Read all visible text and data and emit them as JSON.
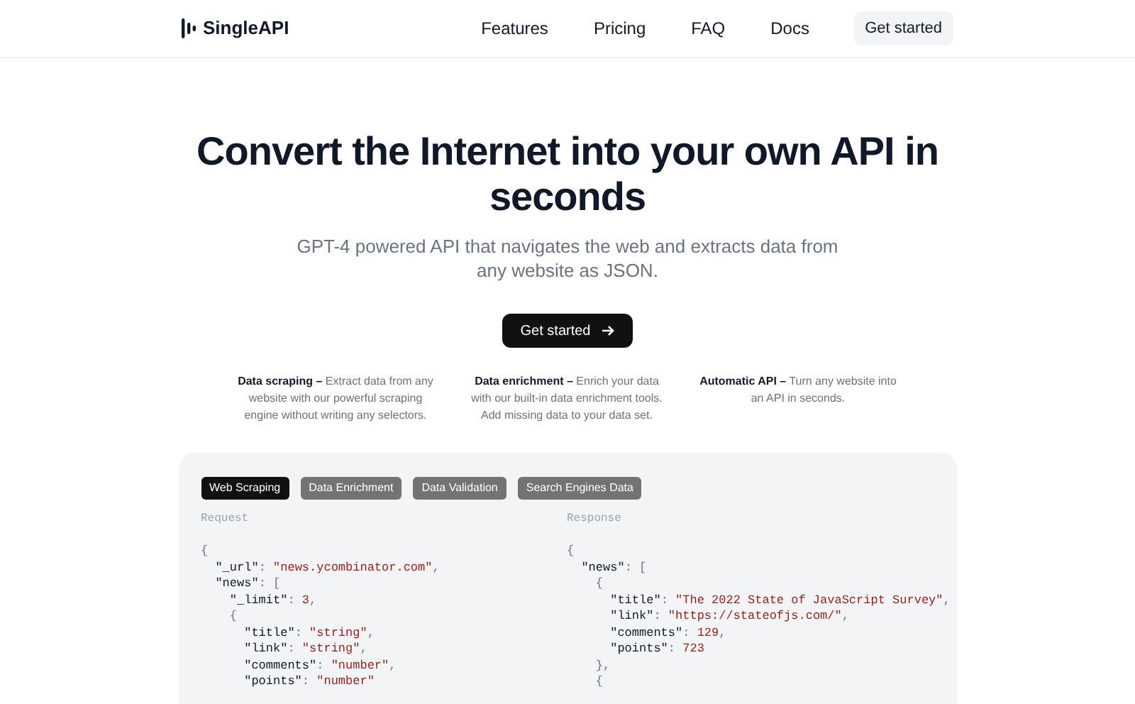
{
  "nav": {
    "brand": "SingleAPI",
    "links": [
      "Features",
      "Pricing",
      "FAQ",
      "Docs"
    ],
    "cta": "Get started"
  },
  "hero": {
    "title": "Convert the Internet into your own API in seconds",
    "subtitle": "GPT-4 powered API that navigates the web and extracts data from any website as JSON.",
    "button": "Get started"
  },
  "features": [
    {
      "name": "Data scraping –",
      "text": "Extract data from any website with our powerful scraping engine without writing any selectors."
    },
    {
      "name": "Data enrichment –",
      "text": "Enrich your data with our built-in data enrichment tools. Add missing data to your data set."
    },
    {
      "name": "Automatic API –",
      "text": "Turn any website into an API in seconds."
    }
  ],
  "demo": {
    "tabs": [
      {
        "label": "Web Scraping",
        "selected": true
      },
      {
        "label": "Data Enrichment",
        "selected": false
      },
      {
        "label": "Data Validation",
        "selected": false
      },
      {
        "label": "Search Engines Data",
        "selected": false
      }
    ],
    "panes": [
      {
        "label": "Request",
        "lines": [
          [
            {
              "kind": "punct",
              "text": "{"
            }
          ],
          [
            {
              "kind": "key",
              "text": "  \"_url\""
            },
            {
              "kind": "punct",
              "text": ": "
            },
            {
              "kind": "string",
              "text": "\"news.ycombinator.com\""
            },
            {
              "kind": "punct",
              "text": ","
            }
          ],
          [
            {
              "kind": "key",
              "text": "  \"news\""
            },
            {
              "kind": "punct",
              "text": ": ["
            }
          ],
          [
            {
              "kind": "key",
              "text": "    \"_limit\""
            },
            {
              "kind": "punct",
              "text": ": "
            },
            {
              "kind": "number",
              "text": "3"
            },
            {
              "kind": "punct",
              "text": ","
            }
          ],
          [
            {
              "kind": "punct",
              "text": "    {"
            }
          ],
          [
            {
              "kind": "key",
              "text": "      \"title\""
            },
            {
              "kind": "punct",
              "text": ": "
            },
            {
              "kind": "string",
              "text": "\"string\""
            },
            {
              "kind": "punct",
              "text": ","
            }
          ],
          [
            {
              "kind": "key",
              "text": "      \"link\""
            },
            {
              "kind": "punct",
              "text": ": "
            },
            {
              "kind": "string",
              "text": "\"string\""
            },
            {
              "kind": "punct",
              "text": ","
            }
          ],
          [
            {
              "kind": "key",
              "text": "      \"comments\""
            },
            {
              "kind": "punct",
              "text": ": "
            },
            {
              "kind": "string",
              "text": "\"number\""
            },
            {
              "kind": "punct",
              "text": ","
            }
          ],
          [
            {
              "kind": "key",
              "text": "      \"points\""
            },
            {
              "kind": "punct",
              "text": ": "
            },
            {
              "kind": "string",
              "text": "\"number\""
            }
          ]
        ]
      },
      {
        "label": "Response",
        "lines": [
          [
            {
              "kind": "punct",
              "text": "{"
            }
          ],
          [
            {
              "kind": "key",
              "text": "  \"news\""
            },
            {
              "kind": "punct",
              "text": ": ["
            }
          ],
          [
            {
              "kind": "punct",
              "text": "    {"
            }
          ],
          [
            {
              "kind": "key",
              "text": "      \"title\""
            },
            {
              "kind": "punct",
              "text": ": "
            },
            {
              "kind": "string",
              "text": "\"The 2022 State of JavaScript Survey\""
            },
            {
              "kind": "punct",
              "text": ","
            }
          ],
          [
            {
              "kind": "key",
              "text": "      \"link\""
            },
            {
              "kind": "punct",
              "text": ": "
            },
            {
              "kind": "string",
              "text": "\"https://stateofjs.com/\""
            },
            {
              "kind": "punct",
              "text": ","
            }
          ],
          [
            {
              "kind": "key",
              "text": "      \"comments\""
            },
            {
              "kind": "punct",
              "text": ": "
            },
            {
              "kind": "number",
              "text": "129"
            },
            {
              "kind": "punct",
              "text": ","
            }
          ],
          [
            {
              "kind": "key",
              "text": "      \"points\""
            },
            {
              "kind": "punct",
              "text": ": "
            },
            {
              "kind": "number",
              "text": "723"
            }
          ],
          [
            {
              "kind": "punct",
              "text": "    },"
            }
          ],
          [
            {
              "kind": "punct",
              "text": "    {"
            }
          ]
        ]
      }
    ]
  }
}
